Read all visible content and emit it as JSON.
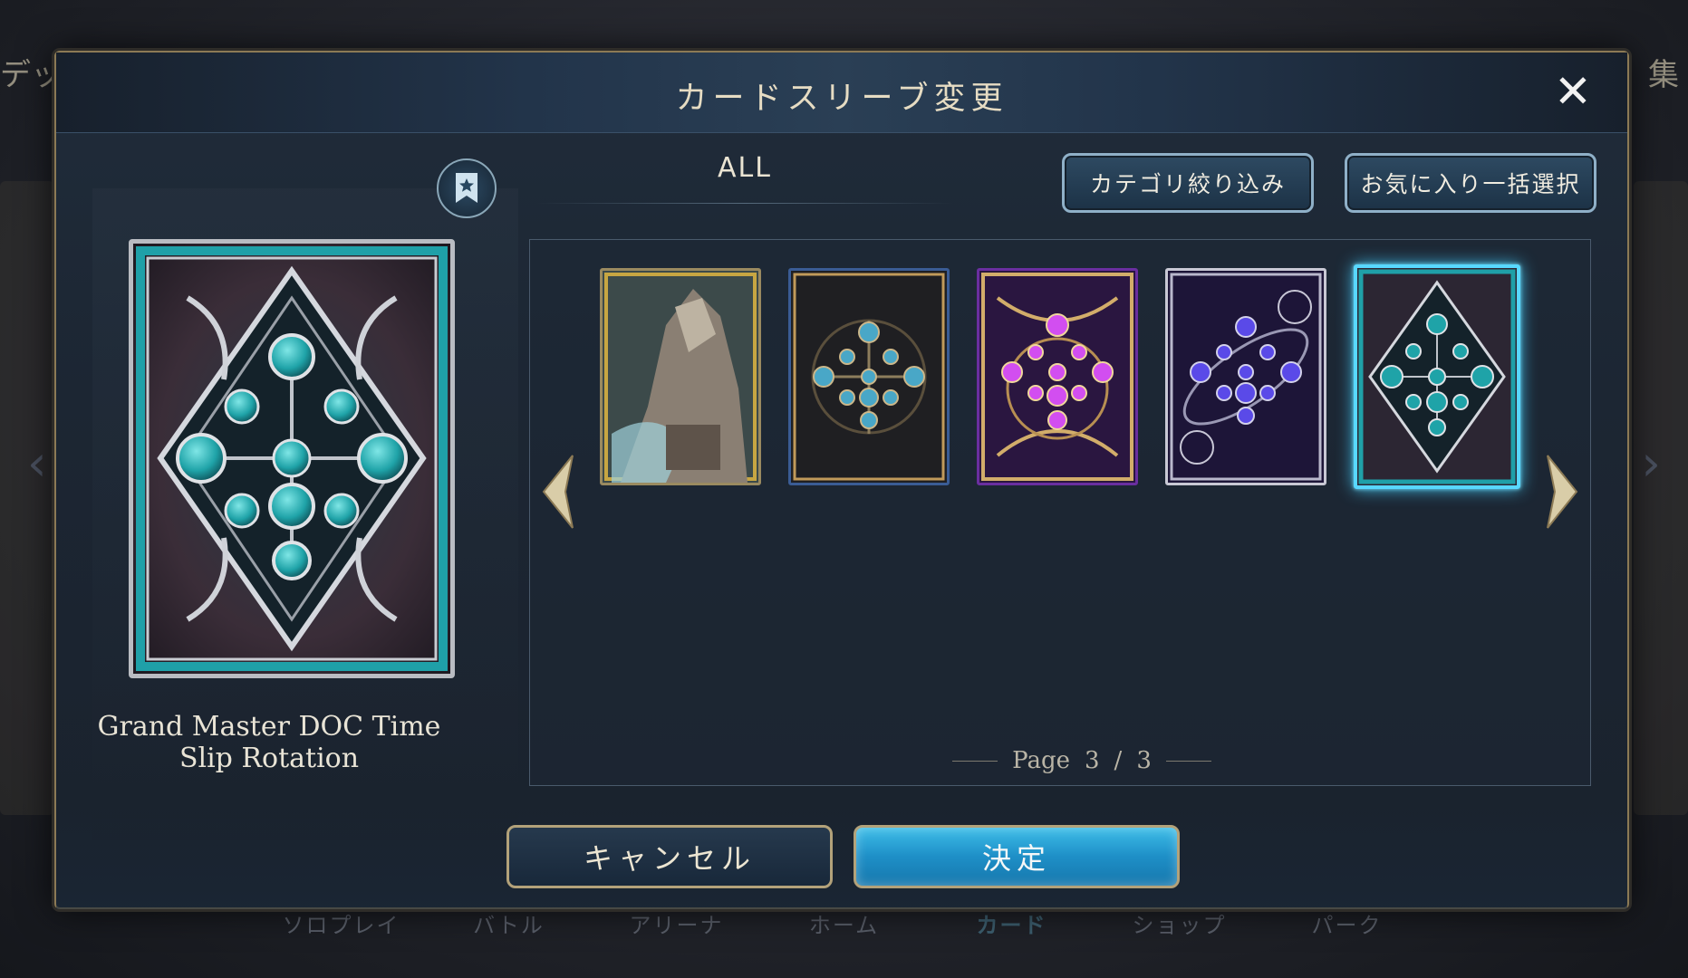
{
  "modal": {
    "title": "カードスリーブ変更",
    "close_icon": "close-icon"
  },
  "left_panel": {
    "favorite_icon": "bookmark-star-icon",
    "selected_sleeve_name": "Grand Master DOC Time Slip Rotation"
  },
  "filter": {
    "current": "ALL",
    "category_button": "カテゴリ絞り込み",
    "favorite_select_button": "お気に入り一括選択"
  },
  "sleeves": [
    {
      "name": "sleeve-1",
      "style": "armored-knight-art",
      "selected": false
    },
    {
      "name": "sleeve-2",
      "style": "dark-teal-orbs",
      "selected": false
    },
    {
      "name": "sleeve-3",
      "style": "gold-magenta-orbs",
      "selected": false
    },
    {
      "name": "sleeve-4",
      "style": "purple-cosmic-orbs",
      "selected": false
    },
    {
      "name": "sleeve-5",
      "style": "silver-teal-diamond",
      "selected": true
    }
  ],
  "pager": {
    "label": "Page",
    "current": "3",
    "separator": "/",
    "total": "3"
  },
  "footer": {
    "cancel": "キャンセル",
    "confirm": "決定"
  },
  "background": {
    "left_edge_text": "デッ",
    "right_edge_text": "集",
    "nav": [
      "ソロプレイ",
      "バトル",
      "アリーナ",
      "ホーム",
      "カード",
      "ショップ",
      "パーク"
    ],
    "active_nav": "カード"
  },
  "colors": {
    "accent_cyan": "#58d8ff",
    "gold_border": "#b3a27a",
    "confirm_blue": "#1e8fc7"
  }
}
